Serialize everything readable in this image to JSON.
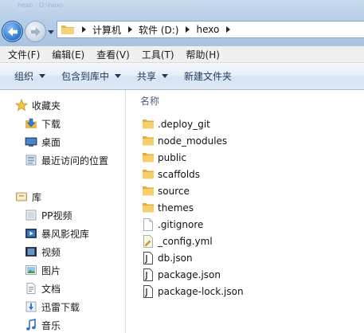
{
  "window": {
    "ghost_title": "hexo · D:\\hexo"
  },
  "address": {
    "crumbs": [
      "计算机",
      "软件 (D:)",
      "hexo"
    ]
  },
  "menu": {
    "items": [
      "文件(F)",
      "编辑(E)",
      "查看(V)",
      "工具(T)",
      "帮助(H)"
    ]
  },
  "toolbar": {
    "organize": "组织",
    "include_in_library": "包含到库中",
    "share": "共享",
    "new_folder": "新建文件夹"
  },
  "navpane": {
    "favorites": {
      "label": "收藏夹",
      "items": [
        "下载",
        "桌面",
        "最近访问的位置"
      ]
    },
    "libraries": {
      "label": "库",
      "items": [
        "PP视频",
        "暴风影视库",
        "视频",
        "图片",
        "文档",
        "迅雷下载",
        "音乐"
      ]
    }
  },
  "content": {
    "column_name": "名称",
    "files": [
      {
        "name": ".deploy_git",
        "type": "folder"
      },
      {
        "name": "node_modules",
        "type": "folder"
      },
      {
        "name": "public",
        "type": "folder"
      },
      {
        "name": "scaffolds",
        "type": "folder"
      },
      {
        "name": "source",
        "type": "folder"
      },
      {
        "name": "themes",
        "type": "folder"
      },
      {
        "name": ".gitignore",
        "type": "text"
      },
      {
        "name": "_config.yml",
        "type": "config"
      },
      {
        "name": "db.json",
        "type": "json"
      },
      {
        "name": "package.json",
        "type": "json"
      },
      {
        "name": "package-lock.json",
        "type": "json"
      }
    ]
  },
  "colors": {
    "titlebar": "#b7cfe8",
    "toolbar_text": "#1e395b",
    "folder": "#f1c24e",
    "header_text": "#4c607a"
  }
}
